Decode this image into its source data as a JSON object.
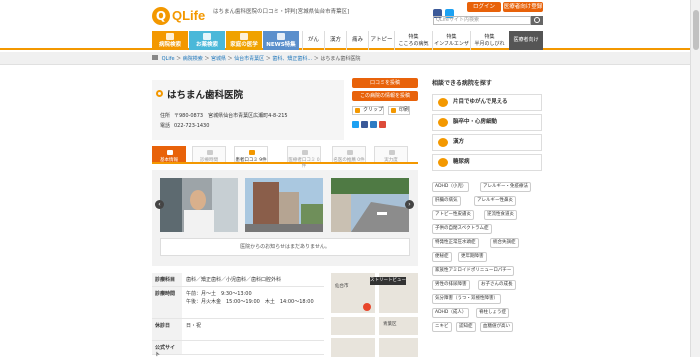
{
  "header": {
    "logo": "QLife",
    "tagline": "はちまん歯科医院の口コミ・評判[宮城県仙台市青葉区]",
    "login": "ログイン",
    "register": "医療者向け登録",
    "search_placeholder": "QLifeサイト内検索"
  },
  "nav": {
    "tabs": [
      {
        "label": "病院検索",
        "color": "#f39800"
      },
      {
        "label": "お薬検索",
        "color": "#4ab8d9"
      },
      {
        "label": "家庭の医学",
        "color": "#f0a200"
      },
      {
        "label": "NEWS特集",
        "color": "#5b8fcc"
      }
    ],
    "links": [
      "がん",
      "漢方",
      "痛み",
      "アトピー"
    ],
    "sub_links": [
      {
        "top": "特集",
        "bottom": "こころの病気"
      },
      {
        "top": "特集",
        "bottom": "インフルエンザ"
      },
      {
        "top": "特集",
        "bottom": "半月のしびれ"
      }
    ],
    "last": "医療者向け"
  },
  "breadcrumb": [
    "QLife",
    "病院検索",
    "宮城県",
    "仙台市青葉区",
    "歯科、矯正歯科...",
    "はちまん歯科医院"
  ],
  "clinic": {
    "name": "はちまん歯科医院",
    "address_label": "住所",
    "address": "〒980-0873　宮城県仙台市青葉区広瀬町4-8-215",
    "phone_label": "電話",
    "phone": "022-723-1430",
    "review_button": "口コミを投稿",
    "info_button": "この病院の情報を投稿",
    "clip": "クリップ",
    "print": "印刷"
  },
  "tabs": [
    {
      "label": "基本情報",
      "state": "orange"
    },
    {
      "label": "診療時間",
      "state": "normal"
    },
    {
      "label": "患者口コミ 9件",
      "state": "active"
    },
    {
      "label": "医療者口コミ 0件",
      "state": "normal"
    },
    {
      "label": "名医の推薦 0件",
      "state": "normal"
    },
    {
      "label": "実力度",
      "state": "normal"
    }
  ],
  "notice": "医院からのお知らせはまだありません。",
  "details": [
    {
      "label": "診療科目",
      "value": "歯科／矯正歯科／小児歯科／歯科口腔外科"
    },
    {
      "label": "診療時間",
      "value": "午前：月〜土　9:30〜13:00\n午後：月火木金　15:00〜19:00　木土　14:00〜18:00"
    },
    {
      "label": "休診日",
      "value": "日・祝"
    },
    {
      "label": "公式サイト",
      "value": ""
    }
  ],
  "map": {
    "streetview": "ストリートビュー",
    "label1": "仙台市",
    "label2": "青葉区"
  },
  "sidebar": {
    "title": "相談できる病院を探す",
    "cards": [
      "片目でゆがんで見える",
      "脳卒中・心房細動",
      "漢方",
      "糖尿病"
    ],
    "chips": [
      "ADHD（小児）",
      "アレルギー・免疫療法",
      "肝臓の病気",
      "アレルギー性鼻炎",
      "アトピー性皮膚炎",
      "逆流性食道炎",
      "子供の自閉スペクトラム症",
      "特発性正常圧水頭症",
      "統合失調症",
      "便秘症",
      "更年期障害",
      "家族性アミロイドポリニューロパチー",
      "男性の排尿障害",
      "お子さんの成長",
      "気分障害（うつ・双極性障害）",
      "ADHD（成人）",
      "脊柱しょう症",
      "ニキビ",
      "認知症",
      "血糖値が高い"
    ]
  },
  "colors": {
    "accent": "#f39800",
    "button": "#e8620a"
  }
}
